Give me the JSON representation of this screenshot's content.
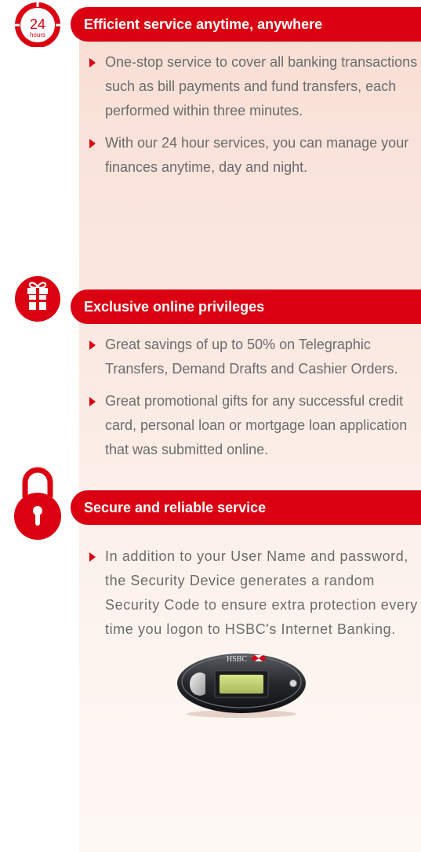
{
  "sections": [
    {
      "title": "Efficient service anytime, anywhere",
      "icon": "24-hours-clock-icon",
      "icon_number": "24",
      "icon_caption": "hours",
      "bullets": [
        "One-stop service to cover all banking transactions such as bill payments and fund transfers, each performed within three minutes.",
        "With our 24 hour services, you can manage your finances anytime, day and night."
      ]
    },
    {
      "title": "Exclusive online privileges",
      "icon": "gift-icon",
      "bullets": [
        "Great savings of up to 50% on Telegraphic Transfers, Demand Drafts and Cashier Orders.",
        "Great promotional gifts for any successful credit card, personal loan or mortgage loan application that was submitted online."
      ]
    },
    {
      "title": "Secure and reliable service",
      "icon": "padlock-icon",
      "bullets": [
        "In addition to your User Name and password, the Security Device generates a random Security Code to ensure extra protection every time you logon to HSBC's Internet Banking."
      ]
    }
  ],
  "device": {
    "brand": "HSBC"
  },
  "colors": {
    "accent": "#db0011",
    "text": "#6b6b6b",
    "panel": "#f8ded4"
  }
}
